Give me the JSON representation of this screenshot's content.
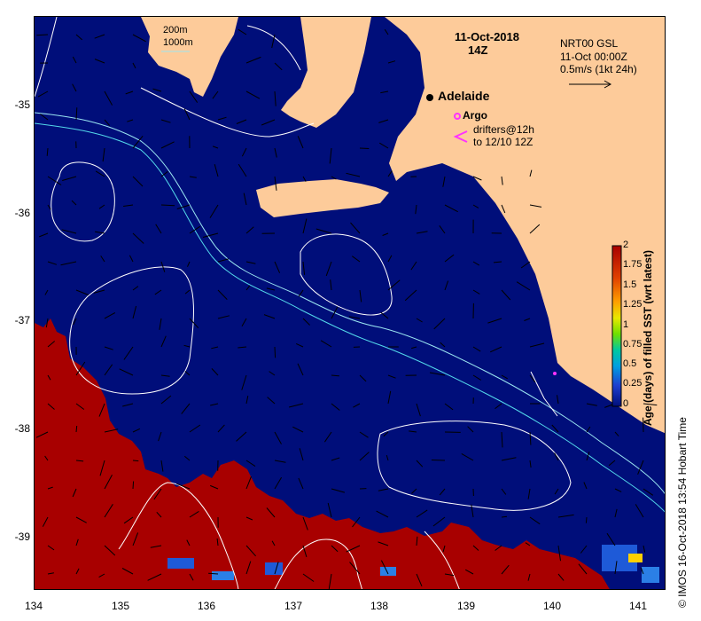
{
  "map": {
    "title_date": "11-Oct-2018",
    "title_time": "14Z",
    "axis_x_labels": [
      "134",
      "135",
      "136",
      "137",
      "138",
      "139",
      "140",
      "141"
    ],
    "axis_y_labels": [
      "-35",
      "-36",
      "-37",
      "-38",
      "-39"
    ],
    "lon_range": [
      134,
      141.3
    ],
    "lat_range": [
      -39.5,
      -34.2
    ],
    "place_label": "Adelaide",
    "isobath_legend": [
      "200m",
      "1000m"
    ],
    "current_legend": [
      "NRT00 GSL",
      "11-Oct 00:00Z",
      "0.5m/s (1kt 24h)"
    ],
    "argo_label": "Argo",
    "drifter_label_1": "drifters@12h",
    "drifter_label_2": "to 12/10 12Z",
    "colorbar_title": "Age (days) of filled SST (wrt latest)",
    "colorbar_ticks": [
      "2",
      "1.75",
      "1.5",
      "1.25",
      "1",
      "0.75",
      "0.5",
      "0.25",
      "0"
    ],
    "credit": "© IMOS 16-Oct-2018 13:54 Hobart Time",
    "colors": {
      "ocean": "#000e7a",
      "land": "#fdcb9a",
      "old_sst": "#a80000",
      "isobath_200": "#9ae6f2",
      "isobath_1000": "#53d9eb",
      "argo": "#ff33ff"
    }
  }
}
